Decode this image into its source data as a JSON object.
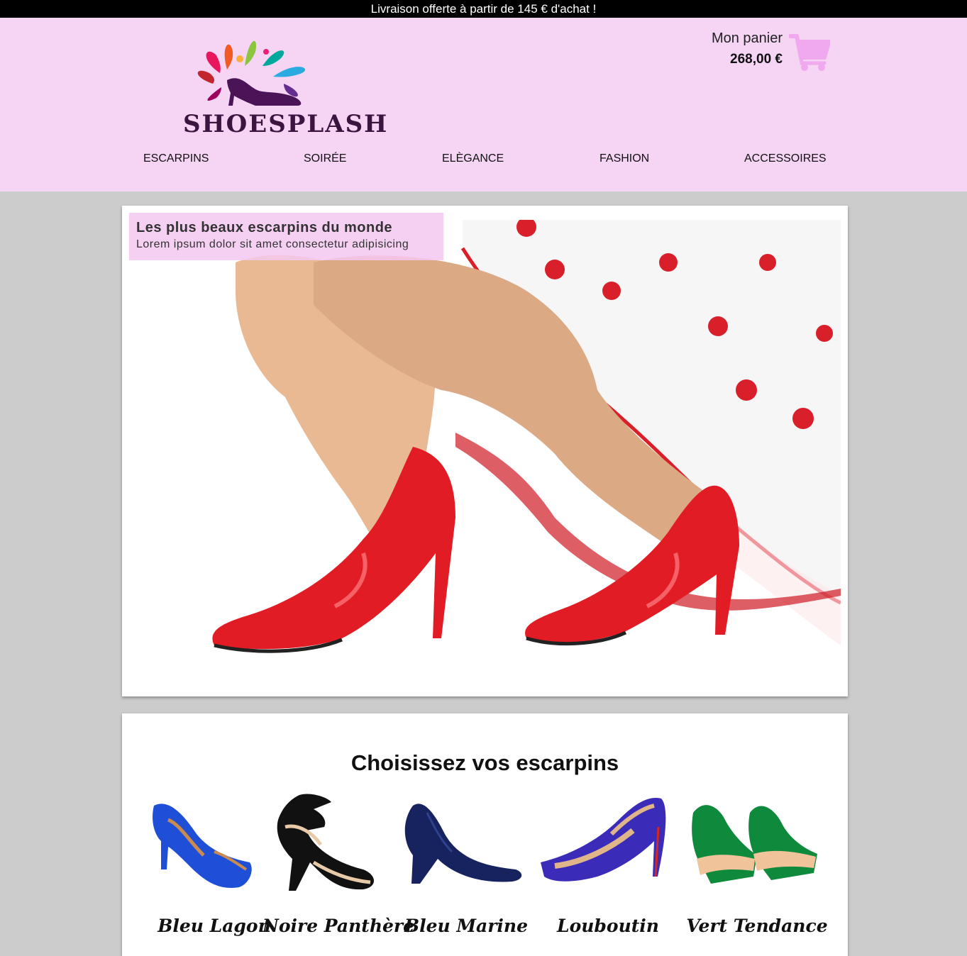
{
  "promo": {
    "text": "Livraison offerte à partir de 145 € d'achat !"
  },
  "header": {
    "logo_text": "SHOESPLASH",
    "cart": {
      "label": "Mon panier",
      "total": "268,00 €",
      "icon": "cart-icon",
      "color": "#f0a8ee"
    },
    "bg_color": "#f5d4f4"
  },
  "nav": {
    "items": [
      {
        "label": "ESCARPINS"
      },
      {
        "label": "SOIRÉE"
      },
      {
        "label": "ELÈGANCE"
      },
      {
        "label": "FASHION"
      },
      {
        "label": "ACCESSOIRES"
      }
    ]
  },
  "hero": {
    "title": "Les plus beaux escarpins du monde",
    "subtitle": "Lorem ipsum dolor sit amet consectetur adipisicing"
  },
  "products": {
    "title": "Choisissez vos escarpins",
    "items": [
      {
        "name": "Bleu Lagon",
        "color": "#1f4fd6"
      },
      {
        "name": "Noire Panthère",
        "color": "#111111"
      },
      {
        "name": "Bleu Marine",
        "color": "#16235f"
      },
      {
        "name": "Louboutin",
        "color": "#3a2bb8"
      },
      {
        "name": "Vert Tendance",
        "color": "#0f8a3c"
      }
    ]
  }
}
